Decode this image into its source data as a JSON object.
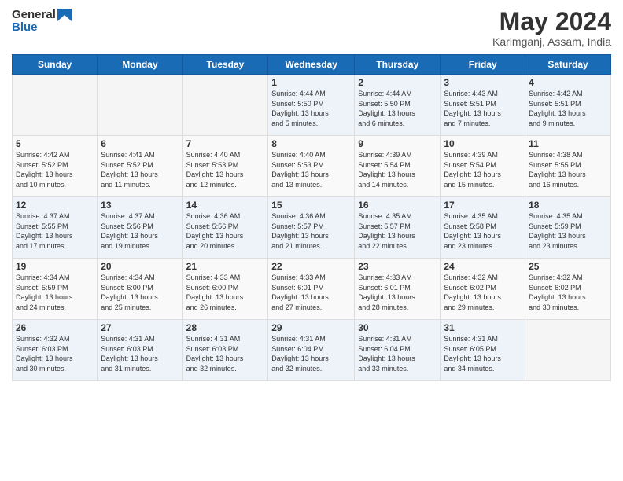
{
  "logo": {
    "general": "General",
    "blue": "Blue"
  },
  "title": {
    "month_year": "May 2024",
    "location": "Karimganj, Assam, India"
  },
  "weekdays": [
    "Sunday",
    "Monday",
    "Tuesday",
    "Wednesday",
    "Thursday",
    "Friday",
    "Saturday"
  ],
  "weeks": [
    [
      {
        "day": "",
        "info": ""
      },
      {
        "day": "",
        "info": ""
      },
      {
        "day": "",
        "info": ""
      },
      {
        "day": "1",
        "info": "Sunrise: 4:44 AM\nSunset: 5:50 PM\nDaylight: 13 hours\nand 5 minutes."
      },
      {
        "day": "2",
        "info": "Sunrise: 4:44 AM\nSunset: 5:50 PM\nDaylight: 13 hours\nand 6 minutes."
      },
      {
        "day": "3",
        "info": "Sunrise: 4:43 AM\nSunset: 5:51 PM\nDaylight: 13 hours\nand 7 minutes."
      },
      {
        "day": "4",
        "info": "Sunrise: 4:42 AM\nSunset: 5:51 PM\nDaylight: 13 hours\nand 9 minutes."
      }
    ],
    [
      {
        "day": "5",
        "info": "Sunrise: 4:42 AM\nSunset: 5:52 PM\nDaylight: 13 hours\nand 10 minutes."
      },
      {
        "day": "6",
        "info": "Sunrise: 4:41 AM\nSunset: 5:52 PM\nDaylight: 13 hours\nand 11 minutes."
      },
      {
        "day": "7",
        "info": "Sunrise: 4:40 AM\nSunset: 5:53 PM\nDaylight: 13 hours\nand 12 minutes."
      },
      {
        "day": "8",
        "info": "Sunrise: 4:40 AM\nSunset: 5:53 PM\nDaylight: 13 hours\nand 13 minutes."
      },
      {
        "day": "9",
        "info": "Sunrise: 4:39 AM\nSunset: 5:54 PM\nDaylight: 13 hours\nand 14 minutes."
      },
      {
        "day": "10",
        "info": "Sunrise: 4:39 AM\nSunset: 5:54 PM\nDaylight: 13 hours\nand 15 minutes."
      },
      {
        "day": "11",
        "info": "Sunrise: 4:38 AM\nSunset: 5:55 PM\nDaylight: 13 hours\nand 16 minutes."
      }
    ],
    [
      {
        "day": "12",
        "info": "Sunrise: 4:37 AM\nSunset: 5:55 PM\nDaylight: 13 hours\nand 17 minutes."
      },
      {
        "day": "13",
        "info": "Sunrise: 4:37 AM\nSunset: 5:56 PM\nDaylight: 13 hours\nand 19 minutes."
      },
      {
        "day": "14",
        "info": "Sunrise: 4:36 AM\nSunset: 5:56 PM\nDaylight: 13 hours\nand 20 minutes."
      },
      {
        "day": "15",
        "info": "Sunrise: 4:36 AM\nSunset: 5:57 PM\nDaylight: 13 hours\nand 21 minutes."
      },
      {
        "day": "16",
        "info": "Sunrise: 4:35 AM\nSunset: 5:57 PM\nDaylight: 13 hours\nand 22 minutes."
      },
      {
        "day": "17",
        "info": "Sunrise: 4:35 AM\nSunset: 5:58 PM\nDaylight: 13 hours\nand 23 minutes."
      },
      {
        "day": "18",
        "info": "Sunrise: 4:35 AM\nSunset: 5:59 PM\nDaylight: 13 hours\nand 23 minutes."
      }
    ],
    [
      {
        "day": "19",
        "info": "Sunrise: 4:34 AM\nSunset: 5:59 PM\nDaylight: 13 hours\nand 24 minutes."
      },
      {
        "day": "20",
        "info": "Sunrise: 4:34 AM\nSunset: 6:00 PM\nDaylight: 13 hours\nand 25 minutes."
      },
      {
        "day": "21",
        "info": "Sunrise: 4:33 AM\nSunset: 6:00 PM\nDaylight: 13 hours\nand 26 minutes."
      },
      {
        "day": "22",
        "info": "Sunrise: 4:33 AM\nSunset: 6:01 PM\nDaylight: 13 hours\nand 27 minutes."
      },
      {
        "day": "23",
        "info": "Sunrise: 4:33 AM\nSunset: 6:01 PM\nDaylight: 13 hours\nand 28 minutes."
      },
      {
        "day": "24",
        "info": "Sunrise: 4:32 AM\nSunset: 6:02 PM\nDaylight: 13 hours\nand 29 minutes."
      },
      {
        "day": "25",
        "info": "Sunrise: 4:32 AM\nSunset: 6:02 PM\nDaylight: 13 hours\nand 30 minutes."
      }
    ],
    [
      {
        "day": "26",
        "info": "Sunrise: 4:32 AM\nSunset: 6:03 PM\nDaylight: 13 hours\nand 30 minutes."
      },
      {
        "day": "27",
        "info": "Sunrise: 4:31 AM\nSunset: 6:03 PM\nDaylight: 13 hours\nand 31 minutes."
      },
      {
        "day": "28",
        "info": "Sunrise: 4:31 AM\nSunset: 6:03 PM\nDaylight: 13 hours\nand 32 minutes."
      },
      {
        "day": "29",
        "info": "Sunrise: 4:31 AM\nSunset: 6:04 PM\nDaylight: 13 hours\nand 32 minutes."
      },
      {
        "day": "30",
        "info": "Sunrise: 4:31 AM\nSunset: 6:04 PM\nDaylight: 13 hours\nand 33 minutes."
      },
      {
        "day": "31",
        "info": "Sunrise: 4:31 AM\nSunset: 6:05 PM\nDaylight: 13 hours\nand 34 minutes."
      },
      {
        "day": "",
        "info": ""
      }
    ]
  ]
}
